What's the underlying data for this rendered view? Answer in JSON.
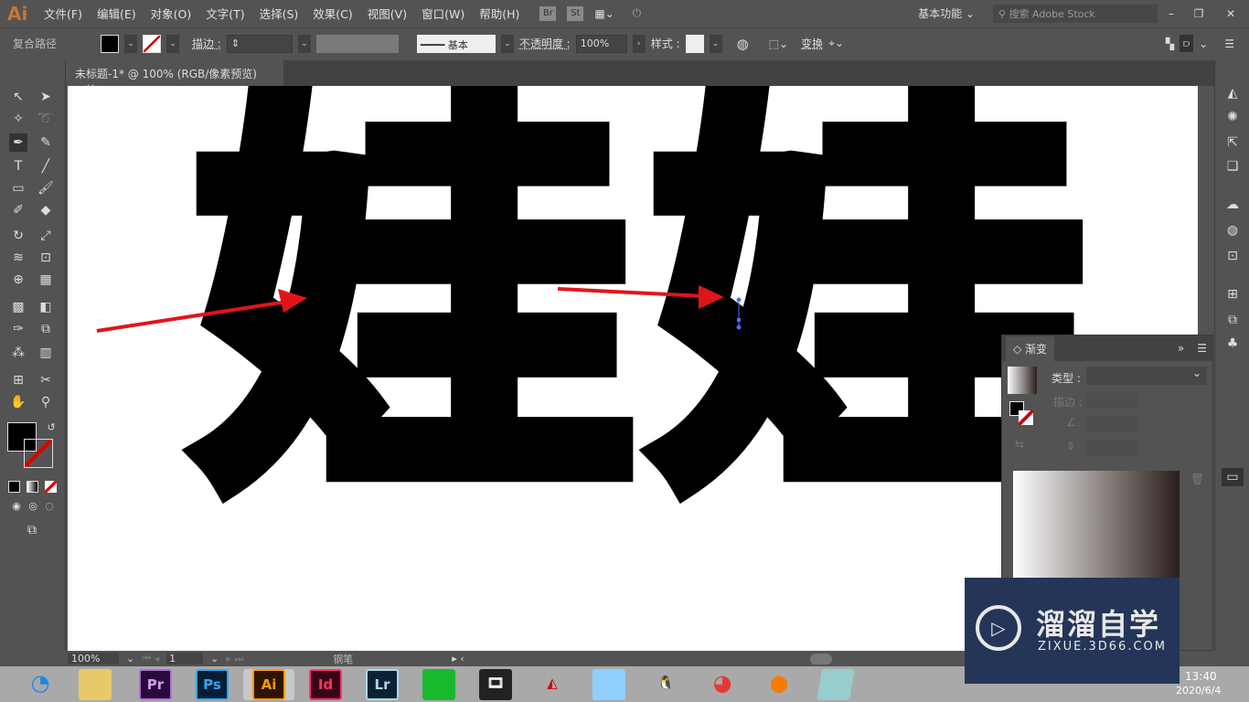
{
  "app": {
    "logo": "Ai",
    "menus": [
      "文件(F)",
      "编辑(E)",
      "对象(O)",
      "文字(T)",
      "选择(S)",
      "效果(C)",
      "视图(V)",
      "窗口(W)",
      "帮助(H)"
    ],
    "bridge": "Br",
    "stock": "St",
    "workspace": "基本功能",
    "search_placeholder": "搜索 Adobe Stock"
  },
  "control": {
    "selection": "复合路径",
    "stroke_label": "描边 :",
    "stroke_style": "基本",
    "opacity_label": "不透明度 :",
    "opacity": "100%",
    "style_label": "样式 :",
    "transform": "变换"
  },
  "document": {
    "tab": "未标题-1* @ 100% (RGB/像素预览)",
    "close": "×",
    "artwork_text": [
      "娃",
      "娃"
    ]
  },
  "gradient_panel": {
    "title": "渐变",
    "type_label": "类型 :",
    "stroke_label": "描边 :",
    "type_value": ""
  },
  "status": {
    "zoom": "100%",
    "page": "1",
    "tool": "钢笔"
  },
  "taskbar": {
    "apps": [
      "Pr",
      "Ps",
      "Ai",
      "Id",
      "Lr"
    ],
    "time": "13:40",
    "date": "2020/6/4"
  },
  "watermark": {
    "name": "溜溜自学",
    "url": "ZIXUE.3D66.COM"
  },
  "colors": {
    "accent": "#e25822",
    "arrow": "#e0151b",
    "anchor": "#4a6cf7"
  }
}
